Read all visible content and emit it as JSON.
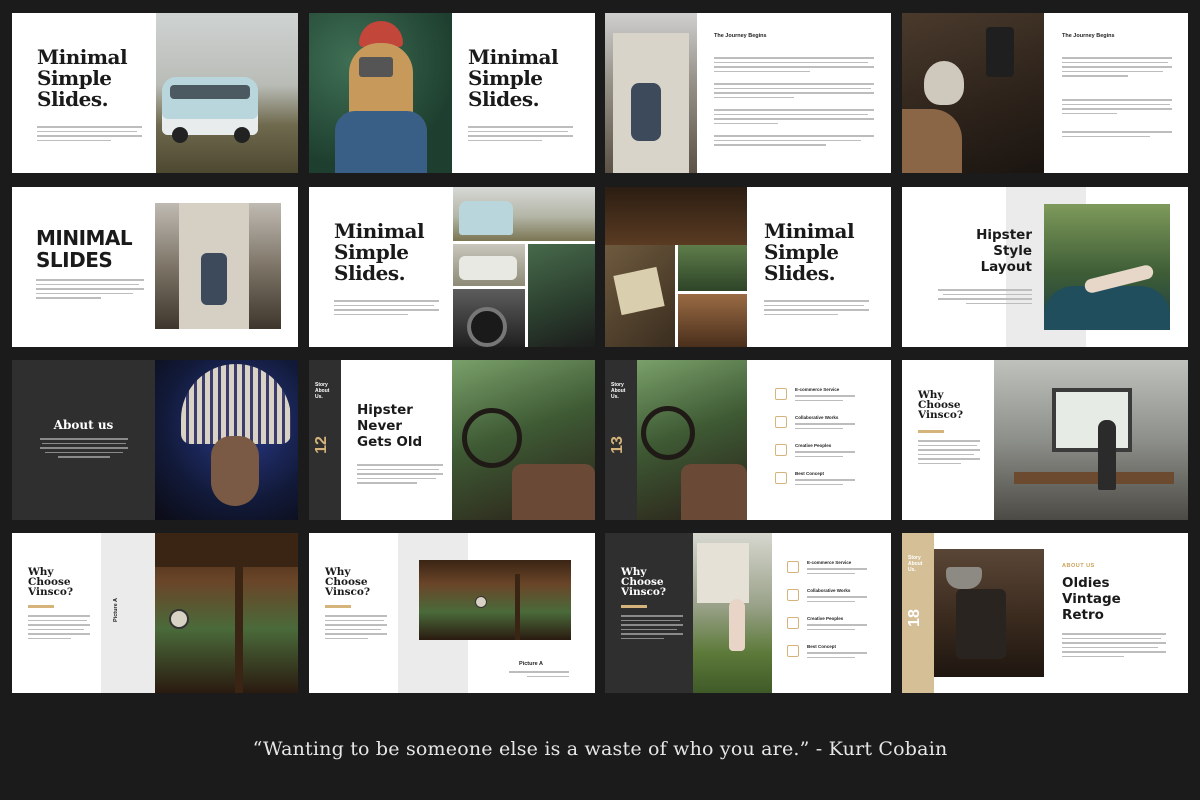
{
  "colors": {
    "background": "#1b1b1b",
    "gold": "#d4b47a",
    "dark_panel": "#2f2f2f"
  },
  "slides": {
    "s1": {
      "title": "Minimal\nSimple\nSlides."
    },
    "s2": {
      "title": "Minimal\nSimple\nSlides."
    },
    "s3": {
      "heading": "The Journey Begins"
    },
    "s4": {
      "heading": "The Journey Begins"
    },
    "s5": {
      "title": "MINIMAL\nSLIDES"
    },
    "s6": {
      "title": "Minimal\nSimple\nSlides."
    },
    "s7": {
      "title": "Minimal\nSimple\nSlides."
    },
    "s8": {
      "title": "Hipster\nStyle\nLayout"
    },
    "s9": {
      "title": "About us"
    },
    "s10": {
      "side_label": "Story\nAbout\nUs.",
      "number": "12",
      "title": "Hipster\nNever\nGets Old"
    },
    "s11": {
      "side_label": "Story\nAbout\nUs.",
      "number": "13",
      "services": [
        "E-commerce Service",
        "Collaborative Works",
        "Creative Peoples",
        "Best Concept"
      ]
    },
    "s12": {
      "title": "Why\nChoose\nVinsco?"
    },
    "s13": {
      "title": "Why\nChoose\nVinsco?",
      "caption": "Picture A"
    },
    "s14": {
      "title": "Why\nChoose\nVinsco?",
      "caption": "Picture A"
    },
    "s15": {
      "title": "Why\nChoose\nVinsco?",
      "services": [
        "E-commerce Service",
        "Collaborative Works",
        "Creative Peoples",
        "Best Concept"
      ]
    },
    "s16": {
      "side_label": "Story\nAbout\nUs.",
      "number": "18",
      "kicker": "ABOUT US",
      "title": "Oldies\nVintage\nRetro"
    }
  },
  "quote": "“Wanting to be someone else is a waste of who you are.” - Kurt Cobain"
}
